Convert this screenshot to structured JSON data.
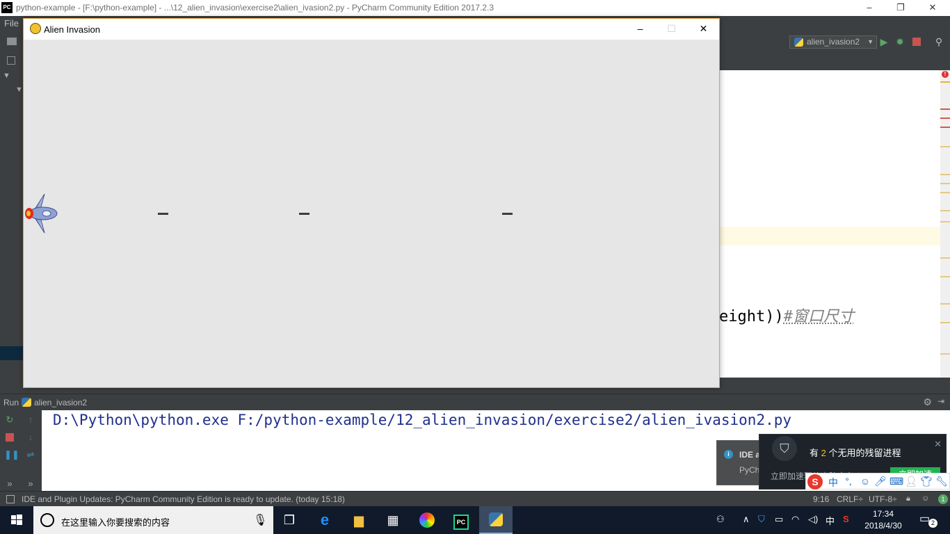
{
  "ide": {
    "window_title": "python-example - [F:\\python-example] - ...\\12_alien_invasion\\exercise2\\alien_ivasion2.py - PyCharm Community Edition 2017.2.3",
    "logo_text": "PC",
    "menu": {
      "file": "File"
    },
    "run_config": "alien_ivasion2",
    "code_fragment": "eight))",
    "code_comment": "#窗口尺寸",
    "error_count": "!"
  },
  "alien_window": {
    "title": "Alien Invasion",
    "background": "#e6e6e6",
    "bullet_color": "#3c3c3c"
  },
  "run_panel": {
    "label": "Run",
    "config": "alien_ivasion2",
    "console_command": "D:\\Python\\python.exe F:/python-example/12_alien_invasion/exercise2/alien_ivasion2.py"
  },
  "ide_balloon": {
    "title": "IDE a",
    "text": "PyCh"
  },
  "security_toast": {
    "prefix": "有",
    "count": "2",
    "suffix": "个无用的残留进程",
    "sub": "立即加速释放电脑内存",
    "button": "立即加速"
  },
  "ime": {
    "logo": "S",
    "mode": "中"
  },
  "status_bar": {
    "message": "IDE and Plugin Updates: PyCharm Community Edition is ready to update. (today 15:18)",
    "position": "9:16",
    "line_sep": "CRLF÷",
    "encoding": "UTF-8÷",
    "event_count": "1"
  },
  "taskbar": {
    "search_placeholder": "在这里输入你要搜索的内容",
    "ime_indicator": "中",
    "time": "17:34",
    "date": "2018/4/30",
    "notification_count": "2"
  }
}
